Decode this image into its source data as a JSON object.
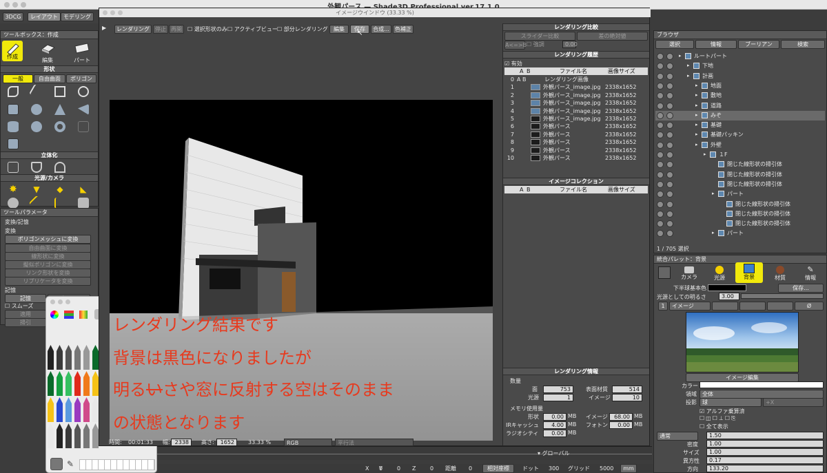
{
  "menubar": {
    "title": "外観パース — Shade3D Professional ver.17.1.0"
  },
  "main_window": {
    "subtitle": "イメージウインドウ (33.33 %)"
  },
  "mode_tabs": [
    "3DCG",
    "レイアウト",
    "モデリング"
  ],
  "toolbox": {
    "title": "ツールボックス：作成",
    "tabs": [
      "作成",
      "編集",
      "パート"
    ],
    "shape_section": "形状",
    "shape_tabs": [
      "一般",
      "自由曲面",
      "ポリゴン"
    ],
    "solid_section": "立体化",
    "light_section": "光源/カメラ"
  },
  "tool_params": {
    "title": "ツールパラメータ",
    "section": "変換/記憶",
    "convert_label": "変換",
    "buttons": [
      "ポリゴンメッシュに変換",
      "自由曲面に変換",
      "線形状に変換",
      "擬似ポリゴンに変換",
      "リンク形状を変換",
      "リプリケータを変換"
    ],
    "memory_label": "記憶",
    "memory_buttons": [
      "記憶",
      "クリア"
    ],
    "smooth_label": "スムーズ",
    "apply_label": "適用",
    "undo_label": "掃引"
  },
  "render_toolbar": {
    "buttons": [
      "レンダリング",
      "停止",
      "再開"
    ],
    "checks": [
      "選択形状のみ",
      "アクティブビュー",
      "部分レンダリング"
    ],
    "actions": [
      "編集",
      "保存",
      "合成...",
      "色補正"
    ]
  },
  "overlay_text": [
    "レンダリング結果です",
    "背景は黒色になりましたが",
    "明る",
    "さや窓に反射する空はそのまま",
    "の状態となります"
  ],
  "strike_char": "い",
  "status_bar": {
    "time_label": "時間:",
    "time": "00:01:33",
    "width_label": "幅:",
    "width": "2338",
    "height_label": "高さ:",
    "height": "1652",
    "zoom": "33.33 %",
    "color_mode": "RGB",
    "projection": "平行法"
  },
  "compare_panel": {
    "title": "レンダリング比較",
    "slider_btn": "スライダー比較",
    "diff_btn": "差の絶対値",
    "ab_btn": "A<=>B",
    "emphasis": "強調",
    "value": "0.00"
  },
  "history_panel": {
    "title": "レンダリング履歴",
    "enabled_label": "有効",
    "col_a": "A",
    "col_b": "B",
    "col_file": "ファイル名",
    "col_size": "画像サイズ",
    "rows": [
      {
        "idx": "0",
        "name": "レンダリング画像",
        "size": "",
        "ab": "A  B"
      },
      {
        "idx": "1",
        "name": "外観パース_image.jpg",
        "size": "2338x1652"
      },
      {
        "idx": "2",
        "name": "外観パース_image.jpg",
        "size": "2338x1652"
      },
      {
        "idx": "3",
        "name": "外観パース_image.jpg",
        "size": "2338x1652"
      },
      {
        "idx": "4",
        "name": "外観パース_image.jpg",
        "size": "2338x1652"
      },
      {
        "idx": "5",
        "name": "外観パース_image.jpg",
        "size": "2338x1652"
      },
      {
        "idx": "6",
        "name": "外観パース",
        "size": "2338x1652"
      },
      {
        "idx": "7",
        "name": "外観パース",
        "size": "2338x1652"
      },
      {
        "idx": "8",
        "name": "外観パース",
        "size": "2338x1652"
      },
      {
        "idx": "9",
        "name": "外観パース",
        "size": "2338x1652"
      },
      {
        "idx": "10",
        "name": "外観パース",
        "size": "2338x1652"
      }
    ]
  },
  "collection_panel": {
    "title": "イメージコレクション",
    "col_a": "A",
    "col_b": "B",
    "col_file": "ファイル名",
    "col_size": "画像サイズ"
  },
  "render_info": {
    "title": "レンダリング情報",
    "count_label": "数量",
    "face_label": "面",
    "face": "753",
    "surface_label": "表面材質",
    "surface": "514",
    "light_label": "光源",
    "light": "1",
    "image_label": "イメージ",
    "image": "10",
    "memory_label": "メモリ使用量",
    "shape_label": "形状",
    "shape": "0.00",
    "imgmem_label": "イメージ",
    "imgmem": "68.00",
    "ir_label": "IRキャッシュ",
    "ir": "4.00",
    "photon_label": "フォトン",
    "photon": "0.00",
    "radio_label": "ラジオシティ",
    "radio": "0.00",
    "unit": "MB"
  },
  "browser": {
    "title": "ブラウザ",
    "tabs": [
      "選択",
      "情報",
      "ブーリアン",
      "検索"
    ],
    "tree": [
      {
        "label": "ルートパート",
        "indent": 0
      },
      {
        "label": "下地",
        "indent": 1
      },
      {
        "label": "計画",
        "indent": 1
      },
      {
        "label": "地面",
        "indent": 2
      },
      {
        "label": "敷地",
        "indent": 2
      },
      {
        "label": "道路",
        "indent": 2
      },
      {
        "label": "みぞ",
        "indent": 2
      },
      {
        "label": "基礎",
        "indent": 2
      },
      {
        "label": "基礎パッキン",
        "indent": 2
      },
      {
        "label": "外壁",
        "indent": 2
      },
      {
        "label": "１F",
        "indent": 3
      },
      {
        "label": "閉じた線形状の掃引体",
        "indent": 4
      },
      {
        "label": "閉じた線形状の掃引体",
        "indent": 4
      },
      {
        "label": "閉じた線形状の掃引体",
        "indent": 4
      },
      {
        "label": "パート",
        "indent": 4
      },
      {
        "label": "閉じた線形状の掃引体",
        "indent": 5
      },
      {
        "label": "閉じた線形状の掃引体",
        "indent": 5
      },
      {
        "label": "閉じた線形状の掃引体",
        "indent": 5
      },
      {
        "label": "パート",
        "indent": 4
      }
    ],
    "status": "1 / 705 選択"
  },
  "palette": {
    "title": "統合パレット：背景",
    "tabs": [
      "カメラ",
      "光源",
      "背景",
      "材質",
      "情報"
    ],
    "hemisphere_label": "下半球基本色",
    "save_btn": "保存...",
    "brightness_label": "光源としての明るさ",
    "brightness": "3.00",
    "layer_num": "1",
    "image_dropdown": "イメージ",
    "image_edit": "イメージ編集",
    "color_label": "カラー",
    "region_label": "領域",
    "region": "全体",
    "projection_label": "投影",
    "projection": "球",
    "axis": "+X",
    "alpha_label": "アルファ乗算済",
    "show_all": "全て表示",
    "blend_mode": "通常",
    "blend_value": "1.50",
    "density_label": "密度",
    "density": "1.00",
    "size_label": "サイズ",
    "size": "1.00",
    "aniso_label": "異方性",
    "aniso": "0.17",
    "dir_label": "方向",
    "dir": "133.20"
  },
  "coord_bar": {
    "x": "X",
    "xv": "0",
    "y": "Y",
    "yv": "0",
    "z": "Z",
    "zv": "0",
    "dist": "距離",
    "distv": "0",
    "rel": "相対座標",
    "dot": "ドット",
    "dotv": "300",
    "grid": "グリッド",
    "gridv": "5000",
    "unit": "mm",
    "global": "グローバル"
  }
}
